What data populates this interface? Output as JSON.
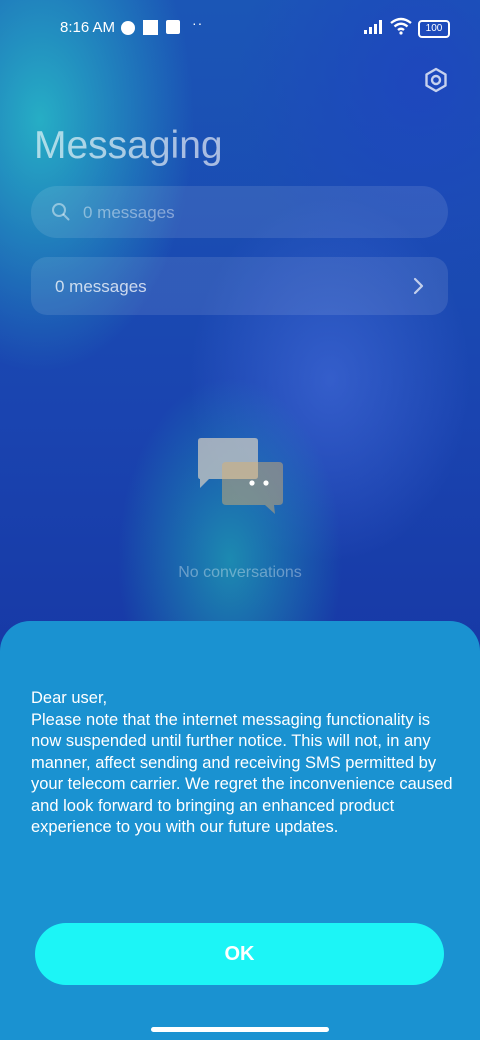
{
  "status_bar": {
    "time": "8:16 AM",
    "more_dots": "··",
    "battery": "100"
  },
  "icons": {
    "settings": "gear-icon",
    "search": "search-icon",
    "chevron": "chevron-right-icon",
    "empty": "chat-bubbles-icon"
  },
  "header": {
    "title": "Messaging"
  },
  "search": {
    "placeholder": "0 messages"
  },
  "messages_row": {
    "label": "0 messages"
  },
  "empty_state": {
    "text": "No conversations"
  },
  "dialog": {
    "message": "Dear user,\nPlease note that the internet messaging functionality is now suspended until further notice. This will not, in any manner, affect sending and receiving SMS permitted by your telecom carrier. We regret the inconvenience caused and look forward to bringing an enhanced product experience to you with our future updates.",
    "ok_label": "OK"
  },
  "colors": {
    "sheet": "#1a92d1",
    "ok_button": "#1cf5f6"
  }
}
